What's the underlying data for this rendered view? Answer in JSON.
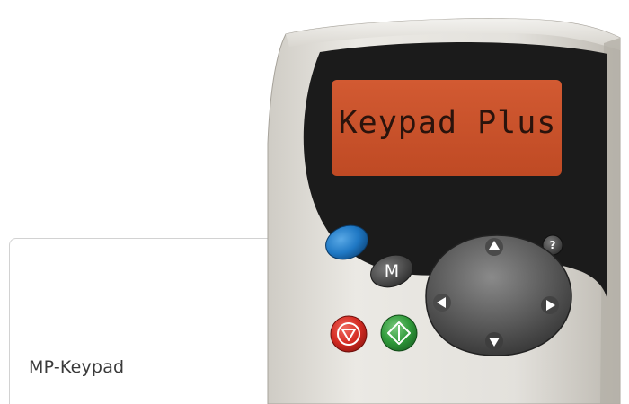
{
  "product": {
    "caption": "MP-Keypad",
    "display_text": "Keypad Plus"
  },
  "keys": {
    "mode_label": "M",
    "help_label": "?",
    "blue_key": "blue-function-key",
    "stop_key": "stop-reset-icon",
    "start_key": "start-run-icon",
    "nav_up": "arrow-up-icon",
    "nav_down": "arrow-down-icon",
    "nav_left": "arrow-left-icon",
    "nav_right": "arrow-right-icon"
  },
  "colors": {
    "lcd": "#c8502b",
    "bezel": "#1b1b1b",
    "body": "#dedcd6",
    "blue_key": "#1f78c4",
    "stop_key": "#d42b22",
    "start_key": "#2f9a3a",
    "nav_pad": "#4e4e4e"
  }
}
